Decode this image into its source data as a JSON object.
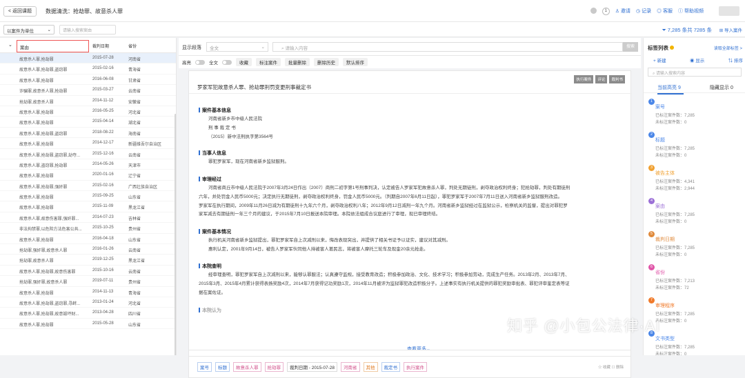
{
  "topbar": {
    "back": "< 返回课题",
    "breadcrumb": "数据清洗：抢劫罪、故意杀人罪",
    "badge": "1",
    "actions": [
      "邀请",
      "记录",
      "客服",
      "帮助视频"
    ]
  },
  "filter": {
    "unit": "以案件为单位",
    "search_placeholder": "请输入搜索案由",
    "count_info": "7,285 条共 7285 条",
    "add_case": "导入案件"
  },
  "table": {
    "headers": {
      "case": "案由",
      "date": "裁判日期",
      "province": "省份"
    },
    "rows": [
      {
        "case": "故意杀人罪,抢劫罪",
        "date": "2015-07-28",
        "prov": "河南省"
      },
      {
        "case": "故意杀人罪,抢劫罪,盗窃罪",
        "date": "2015-02-16",
        "prov": "青海省"
      },
      {
        "case": "故意杀人罪,抢劫罪",
        "date": "2016-06-08",
        "prov": "甘肃省"
      },
      {
        "case": "诈骗罪,故意杀人罪,抢劫罪",
        "date": "2015-03-27",
        "prov": "云南省"
      },
      {
        "case": "抢劫罪,故意杀人罪",
        "date": "2014-11-12",
        "prov": "安徽省"
      },
      {
        "case": "故意杀人罪,抢劫罪",
        "date": "2016-05-25",
        "prov": "河北省"
      },
      {
        "case": "故意杀人罪,抢劫罪",
        "date": "2015-04-14",
        "prov": "湖北省"
      },
      {
        "case": "故意杀人罪,抢劫罪,盗窃罪",
        "date": "2018-08-22",
        "prov": "海南省"
      },
      {
        "case": "故意杀人罪,抢劫罪",
        "date": "2014-12-17",
        "prov": "新疆维吾尔自治区"
      },
      {
        "case": "故意杀人罪,抢劫罪,盗窃罪,劫夺...",
        "date": "2015-12-16",
        "prov": "云南省"
      },
      {
        "case": "故意杀人罪,盗窃罪,抢劫罪",
        "date": "2014-05-26",
        "prov": "天津市"
      },
      {
        "case": "故意杀人罪,抢劫罪",
        "date": "2020-01-16",
        "prov": "辽宁省"
      },
      {
        "case": "故意杀人罪,抢劫罪,强奸罪",
        "date": "2015-02-16",
        "prov": "广西壮族自治区"
      },
      {
        "case": "故意杀人罪,抢劫罪",
        "date": "2015-09-25",
        "prov": "山东省"
      },
      {
        "case": "故意杀人罪,抢劫罪",
        "date": "2015-11-09",
        "prov": "黑龙江省"
      },
      {
        "case": "故意杀人罪,故意伤害罪,强奸罪...",
        "date": "2014-07-23",
        "prov": "吉林省"
      },
      {
        "case": "非法拘禁罪,以危险方法危害公共...",
        "date": "2015-10-25",
        "prov": "贵州省"
      },
      {
        "case": "故意杀人罪,抢劫罪",
        "date": "2016-04-18",
        "prov": "山东省"
      },
      {
        "case": "抢劫罪,强奸罪,故意杀人罪",
        "date": "2016-01-26",
        "prov": "云南省"
      },
      {
        "case": "抢劫罪,故意杀人罪",
        "date": "2019-12-25",
        "prov": "黑龙江省"
      },
      {
        "case": "故意杀人罪,抢劫罪,故意伤害罪",
        "date": "2015-10-16",
        "prov": "云南省"
      },
      {
        "case": "抢劫罪,强奸罪,故意杀人罪",
        "date": "2019-07-11",
        "prov": "贵州省"
      },
      {
        "case": "故意杀人罪,抢劫罪",
        "date": "2014-11-13",
        "prov": "青海省"
      },
      {
        "case": "故意杀人罪,抢劫罪,盗窃罪,寻衅...",
        "date": "2013-01-24",
        "prov": "河北省"
      },
      {
        "case": "故意杀人罪,抢劫罪,故意毁坏财...",
        "date": "2013-04-28",
        "prov": "四川省"
      },
      {
        "case": "故意杀人罪,抢劫罪",
        "date": "2015-05-28",
        "prov": "山东省"
      }
    ]
  },
  "main": {
    "para_label": "显示段落",
    "para_select": "全文",
    "search_placeholder": "请输入内容",
    "search_btn": "搜索",
    "toolbar": [
      "高亮",
      "全文",
      "收藏",
      "标注案件",
      "批量删除",
      "删除历史",
      "默认排序"
    ],
    "doc_buttons": [
      "执行案件",
      "评论",
      "裁判书"
    ],
    "doc_title": "罗家军犯故意杀人罪、抢劫罪刑罚变更刑事裁定书",
    "sections": [
      {
        "title": "案件基本信息",
        "lines": [
          "河南省新乡市中级人民法院",
          "刑 事 裁 定 书",
          "（2015）新中法刑执字第3564号"
        ]
      },
      {
        "title": "当事人信息",
        "lines": [
          "罪犯罗家军，现在河南省新乡监狱服刑。"
        ]
      },
      {
        "title": "审理经过",
        "lines": [
          "河南省商丘市中级人民法院于2007年3月24日作出（2007）商刑二初字第1号刑事判决，认定被告人罗家军犯故意杀人罪，判处无期徒刑，剥夺政治权利终身；犯抢劫罪，判处有期徒刑",
          "六年，并处罚金人民币5000元；决定执行无期徒刑，剥夺政治权利终身，罚金人民币5000元。（判期自2007年6月11日起），罪犯罗家军于2007年7月11日送入河南省新乡监狱服刑改造。",
          "罗家军在执行期间，2009年11月26日减为有期徒刑十九年六个月，剥夺政治权利八年；2012年9月12日减刑一年九个月。河南省新乡监狱经过在监狱公示，检察机关的监督，提出对罪犯罗",
          "家军减去有期徒刑一年三个月的建议，于2015年7月10日报送本院审理。本院依法组成合议庭进行了审理，现已审理终结。"
        ]
      },
      {
        "title": "案件基本情况",
        "lines": [
          "执行机关河南省新乡监狱提出，罪犯罗家军自上次减刑以来，悔改表现突出，并提供了相关书证予以证实，建议对其减刑。",
          "惠利认定，2001年9月14日，被告人罗家军伙同他人持被害人葛民志，将被害人摩托三轮车及现金20余元抢走。"
        ]
      },
      {
        "title": "本院查明",
        "lines": [
          "经审理查明，罪犯罗家军自上次减刑以来，能够认罪服法；认真遵守监规，接受教育改造；积极参加政治、文化、技术学习；积极参加劳动，完成生产任务。2013年2月、2013年7月、",
          "2015年3月、2015年4月累计获得表扬奖励4次，2014年7月获得记功奖励1次，2014年11月被评为监狱罪犯改造积极分子。上述事实有执行机关提供的罪犯奖励审批表、罪犯评审鉴定表等证",
          "据在案佐证。"
        ]
      },
      {
        "title": "本院认为",
        "lines": []
      }
    ],
    "view_more": "查看更多",
    "tags": [
      "案号",
      "标题",
      "故意杀人罪",
      "抢劫罪",
      "裁判日期 - 2015-07-28",
      "河南省",
      "其他",
      "裁定书",
      "执行案件"
    ],
    "doc_foot": "☆ 收藏    ☐ 删除"
  },
  "right": {
    "title": "标签列表",
    "link": "读取全部标签 >",
    "actions": [
      "+ 新建",
      "显示",
      "排序"
    ],
    "search_placeholder": "请输入搜索内容",
    "tab_current": "当前高亮 9",
    "tab_hidden": "隐藏显示 0",
    "tags": [
      {
        "num": "1",
        "name": "案号",
        "s1": "已标注案件数：7,285",
        "s2": "未标注案件数：0",
        "color": "#4a86e8"
      },
      {
        "num": "2",
        "name": "标题",
        "s1": "已标注案件数：7,285",
        "s2": "未标注案件数：0",
        "color": "#4a86e8"
      },
      {
        "num": "3",
        "name": "被告主体",
        "s1": "已标注案件数：4,341",
        "s2": "未标注案件数：2,944",
        "color": "#f0a030"
      },
      {
        "num": "4",
        "name": "案由",
        "s1": "已标注案件数：7,285",
        "s2": "未标注案件数：0",
        "color": "#9b6fd6"
      },
      {
        "num": "5",
        "name": "裁判日期",
        "s1": "已标注案件数：7,285",
        "s2": "未标注案件数：0",
        "color": "#e08a3c"
      },
      {
        "num": "6",
        "name": "省份",
        "s1": "已标注案件数：7,213",
        "s2": "未标注案件数：72",
        "color": "#e055a8"
      },
      {
        "num": "7",
        "name": "审理程序",
        "s1": "已标注案件数：7,285",
        "s2": "未标注案件数：0",
        "color": "#f07a2a"
      },
      {
        "num": "8",
        "name": "文书类型",
        "s1": "已标注案件数：7,285",
        "s2": "未标注案件数：0",
        "color": "#4a86e8"
      }
    ]
  },
  "watermark": "知乎 @小包公法律·AI"
}
